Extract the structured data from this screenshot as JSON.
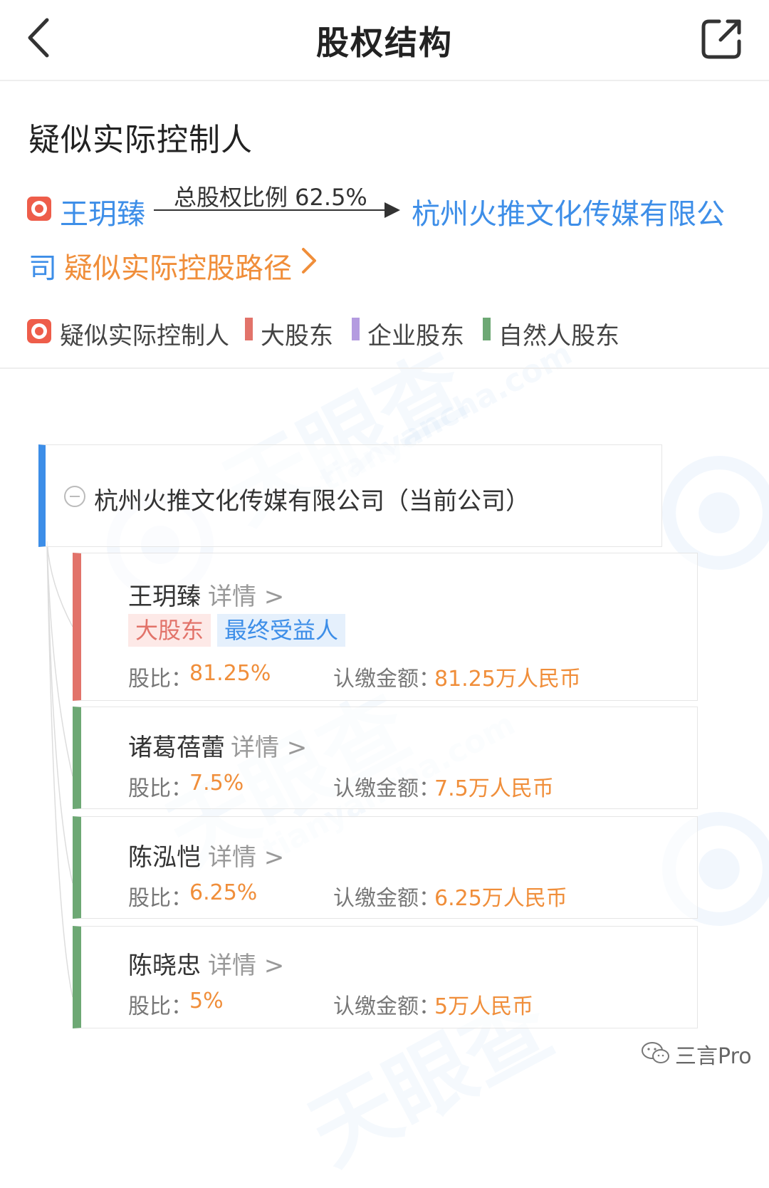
{
  "header": {
    "title": "股权结构",
    "back_icon": "chevron-left-icon",
    "share_icon": "share-external-icon"
  },
  "controller": {
    "section_title": "疑似实际控制人",
    "person": "王玥臻",
    "ratio_label": "总股权比例 62.5%",
    "company_line1": "杭州火推文化传媒有限公",
    "company_line2": "司",
    "path_link": "疑似实际控股路径"
  },
  "legend": {
    "items": [
      {
        "label": "疑似实际控制人",
        "icon": "controller-icon",
        "color": "#ee5d4a"
      },
      {
        "label": "大股东",
        "color": "#e2736a"
      },
      {
        "label": "企业股东",
        "color": "#b49be0"
      },
      {
        "label": "自然人股东",
        "color": "#6da874"
      }
    ]
  },
  "tree": {
    "root": "杭州火推文化传媒有限公司（当前公司）",
    "detail_label": "详情 >",
    "share_label": "股比：",
    "amount_label": "认缴金额：",
    "shareholders": [
      {
        "name": "王玥臻",
        "tags": [
          "大股东",
          "最终受益人"
        ],
        "share": "81.25%",
        "amount": "81.25万人民币",
        "color": "#e2736a"
      },
      {
        "name": "诸葛蓓蕾",
        "share": "7.5%",
        "amount": "7.5万人民币",
        "color": "#6da874"
      },
      {
        "name": "陈泓恺",
        "share": "6.25%",
        "amount": "6.25万人民币",
        "color": "#6da874"
      },
      {
        "name": "陈晓忠",
        "share": "5%",
        "amount": "5万人民币",
        "color": "#6da874"
      }
    ]
  },
  "watermark": {
    "brand": "天眼查",
    "domain": "tianyancha.com"
  },
  "footer": {
    "brand": "三言Pro",
    "icon": "wechat-icon"
  }
}
